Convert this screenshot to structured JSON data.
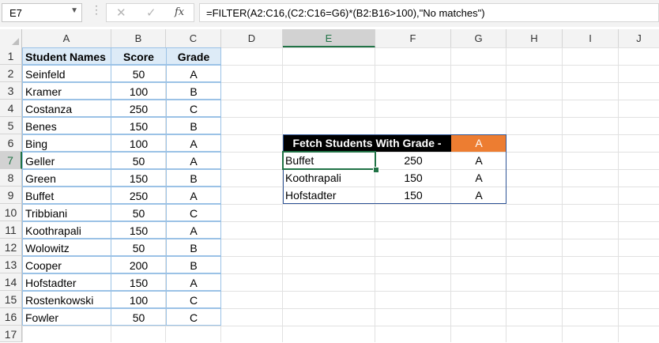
{
  "formula_bar": {
    "name_box": "E7",
    "fx_label": "fx",
    "formula": "=FILTER(A2:C16,(C2:C16=G6)*(B2:B16>100),\"No matches\")"
  },
  "columns": [
    "A",
    "B",
    "C",
    "D",
    "E",
    "F",
    "G",
    "H",
    "I",
    "J"
  ],
  "rows": [
    "1",
    "2",
    "3",
    "4",
    "5",
    "6",
    "7",
    "8",
    "9",
    "10",
    "11",
    "12",
    "13",
    "14",
    "15",
    "16",
    "17"
  ],
  "table": {
    "headers": [
      "Student Names",
      "Score",
      "Grade"
    ],
    "rows": [
      [
        "Seinfeld",
        "50",
        "A"
      ],
      [
        "Kramer",
        "100",
        "B"
      ],
      [
        "Costanza",
        "250",
        "C"
      ],
      [
        "Benes",
        "150",
        "B"
      ],
      [
        "Bing",
        "100",
        "A"
      ],
      [
        "Geller",
        "50",
        "A"
      ],
      [
        "Green",
        "150",
        "B"
      ],
      [
        "Buffet",
        "250",
        "A"
      ],
      [
        "Tribbiani",
        "50",
        "C"
      ],
      [
        "Koothrapali",
        "150",
        "A"
      ],
      [
        "Wolowitz",
        "50",
        "B"
      ],
      [
        "Cooper",
        "200",
        "B"
      ],
      [
        "Hofstadter",
        "150",
        "A"
      ],
      [
        "Rostenkowski",
        "100",
        "C"
      ],
      [
        "Fowler",
        "50",
        "C"
      ]
    ]
  },
  "lookup": {
    "title": "Fetch Students With Grade -",
    "grade": "A",
    "results": [
      [
        "Buffet",
        "250",
        "A"
      ],
      [
        "Koothrapali",
        "150",
        "A"
      ],
      [
        "Hofstadter",
        "150",
        "A"
      ]
    ]
  },
  "selected_cell": "E7",
  "colors": {
    "accent": "#217346",
    "header_fill": "#ddebf7",
    "title_fill": "#000000",
    "grade_fill": "#ed7d31",
    "table_border": "#9bc2e6"
  }
}
